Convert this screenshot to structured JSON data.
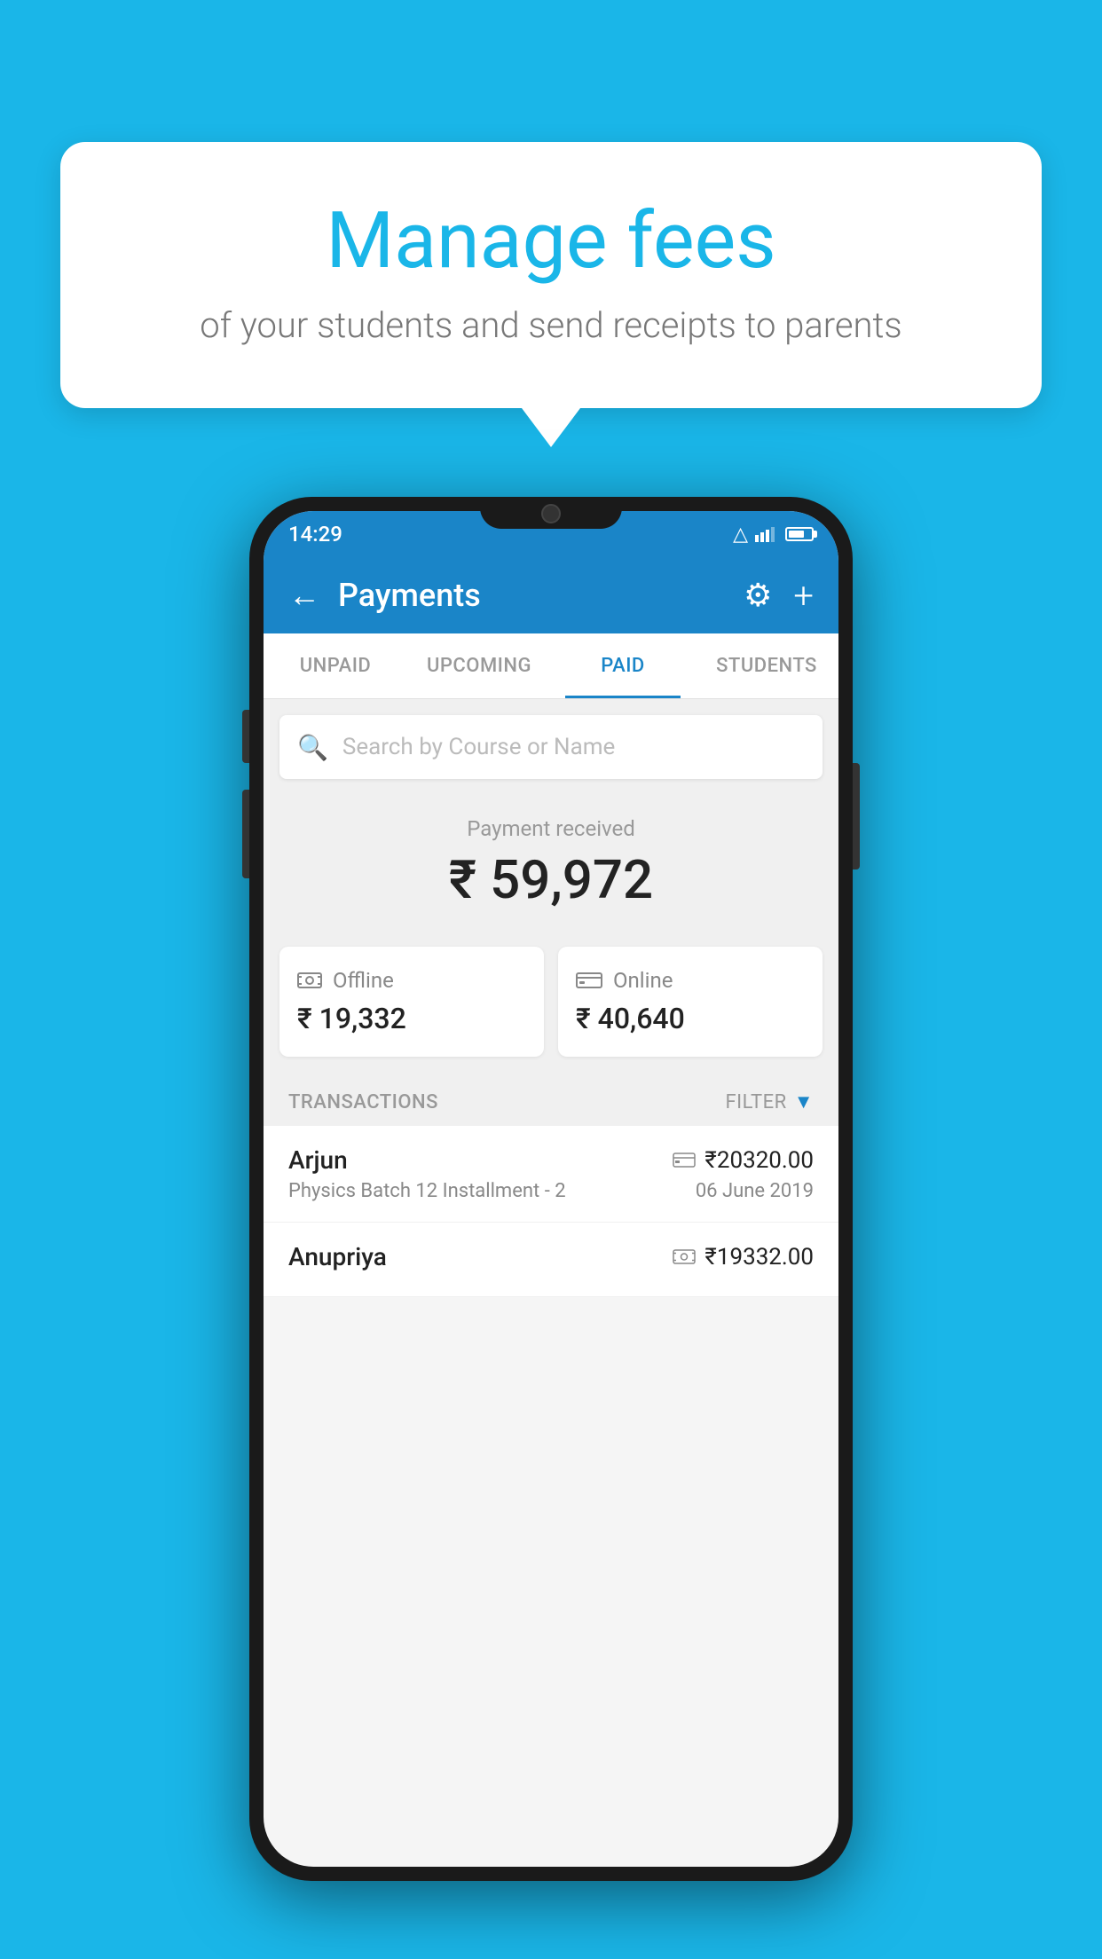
{
  "page": {
    "background_color": "#1ab6e8"
  },
  "speech_bubble": {
    "title": "Manage fees",
    "subtitle": "of your students and send receipts to parents"
  },
  "status_bar": {
    "time": "14:29"
  },
  "app_bar": {
    "title": "Payments",
    "back_label": "←",
    "gear_label": "⚙",
    "plus_label": "+"
  },
  "tabs": [
    {
      "label": "UNPAID",
      "active": false
    },
    {
      "label": "UPCOMING",
      "active": false
    },
    {
      "label": "PAID",
      "active": true
    },
    {
      "label": "STUDENTS",
      "active": false
    }
  ],
  "search": {
    "placeholder": "Search by Course or Name"
  },
  "payment_summary": {
    "label": "Payment received",
    "total": "₹ 59,972",
    "offline_label": "Offline",
    "offline_amount": "₹ 19,332",
    "online_label": "Online",
    "online_amount": "₹ 40,640"
  },
  "transactions": {
    "section_label": "TRANSACTIONS",
    "filter_label": "FILTER",
    "items": [
      {
        "name": "Arjun",
        "amount": "₹20320.00",
        "course": "Physics Batch 12 Installment - 2",
        "date": "06 June 2019",
        "payment_type": "card"
      },
      {
        "name": "Anupriya",
        "amount": "₹19332.00",
        "course": "",
        "date": "",
        "payment_type": "cash"
      }
    ]
  }
}
